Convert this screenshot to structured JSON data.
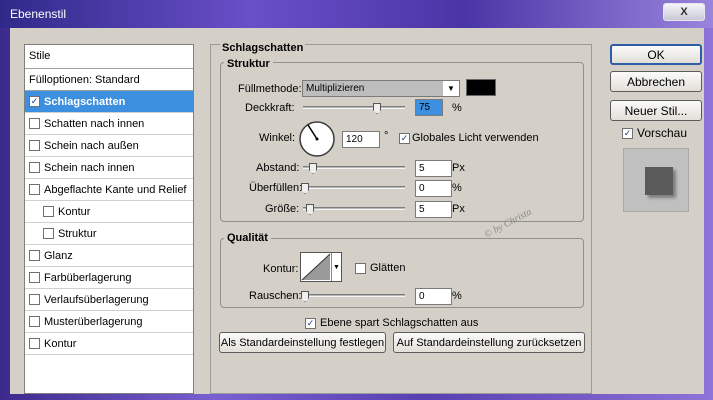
{
  "window": {
    "title": "Ebenenstil",
    "close_label": "X"
  },
  "styles": {
    "header": "Stile",
    "items": [
      {
        "label": "Fülloptionen: Standard",
        "checkbox": false,
        "checked": false,
        "selected": false,
        "sub": false
      },
      {
        "label": "Schlagschatten",
        "checkbox": true,
        "checked": true,
        "selected": true,
        "sub": false
      },
      {
        "label": "Schatten nach innen",
        "checkbox": true,
        "checked": false,
        "selected": false,
        "sub": false
      },
      {
        "label": "Schein nach außen",
        "checkbox": true,
        "checked": false,
        "selected": false,
        "sub": false
      },
      {
        "label": "Schein nach innen",
        "checkbox": true,
        "checked": false,
        "selected": false,
        "sub": false
      },
      {
        "label": "Abgeflachte Kante und Relief",
        "checkbox": true,
        "checked": false,
        "selected": false,
        "sub": false
      },
      {
        "label": "Kontur",
        "checkbox": true,
        "checked": false,
        "selected": false,
        "sub": true
      },
      {
        "label": "Struktur",
        "checkbox": true,
        "checked": false,
        "selected": false,
        "sub": true
      },
      {
        "label": "Glanz",
        "checkbox": true,
        "checked": false,
        "selected": false,
        "sub": false
      },
      {
        "label": "Farbüberlagerung",
        "checkbox": true,
        "checked": false,
        "selected": false,
        "sub": false
      },
      {
        "label": "Verlaufsüberlagerung",
        "checkbox": true,
        "checked": false,
        "selected": false,
        "sub": false
      },
      {
        "label": "Musterüberlagerung",
        "checkbox": true,
        "checked": false,
        "selected": false,
        "sub": false
      },
      {
        "label": "Kontur",
        "checkbox": true,
        "checked": false,
        "selected": false,
        "sub": false
      }
    ]
  },
  "panel": {
    "title": "Schlagschatten",
    "struktur": {
      "title": "Struktur",
      "fuellmethode_label": "Füllmethode:",
      "fuellmethode_value": "Multiplizieren",
      "shadow_color": "#000000",
      "deckkraft_label": "Deckkraft:",
      "deckkraft_value": "75",
      "deckkraft_unit": "%",
      "winkel_label": "Winkel:",
      "winkel_value": "120",
      "winkel_unit": "°",
      "globales_licht_label": "Globales Licht verwenden",
      "globales_licht_checked": true,
      "abstand_label": "Abstand:",
      "abstand_value": "5",
      "abstand_unit": "Px",
      "ueberfuellen_label": "Überfüllen:",
      "ueberfuellen_value": "0",
      "ueberfuellen_unit": "%",
      "groesse_label": "Größe:",
      "groesse_value": "5",
      "groesse_unit": "Px"
    },
    "qualitaet": {
      "title": "Qualität",
      "kontur_label": "Kontur:",
      "glaetten_label": "Glätten",
      "glaetten_checked": false,
      "rauschen_label": "Rauschen:",
      "rauschen_value": "0",
      "rauschen_unit": "%"
    },
    "ebene_spart_label": "Ebene spart Schlagschatten aus",
    "ebene_spart_checked": true,
    "standard_festlegen": "Als Standardeinstellung festlegen",
    "standard_zuruecksetzen": "Auf Standardeinstellung zurücksetzen",
    "watermark": "© by Christa"
  },
  "right": {
    "ok": "OK",
    "abbrechen": "Abbrechen",
    "neuer_stil": "Neuer Stil...",
    "vorschau_label": "Vorschau",
    "vorschau_checked": true
  },
  "colors": {
    "selection": "#3d8fe0",
    "dialog_bg": "#d4d0c8"
  }
}
